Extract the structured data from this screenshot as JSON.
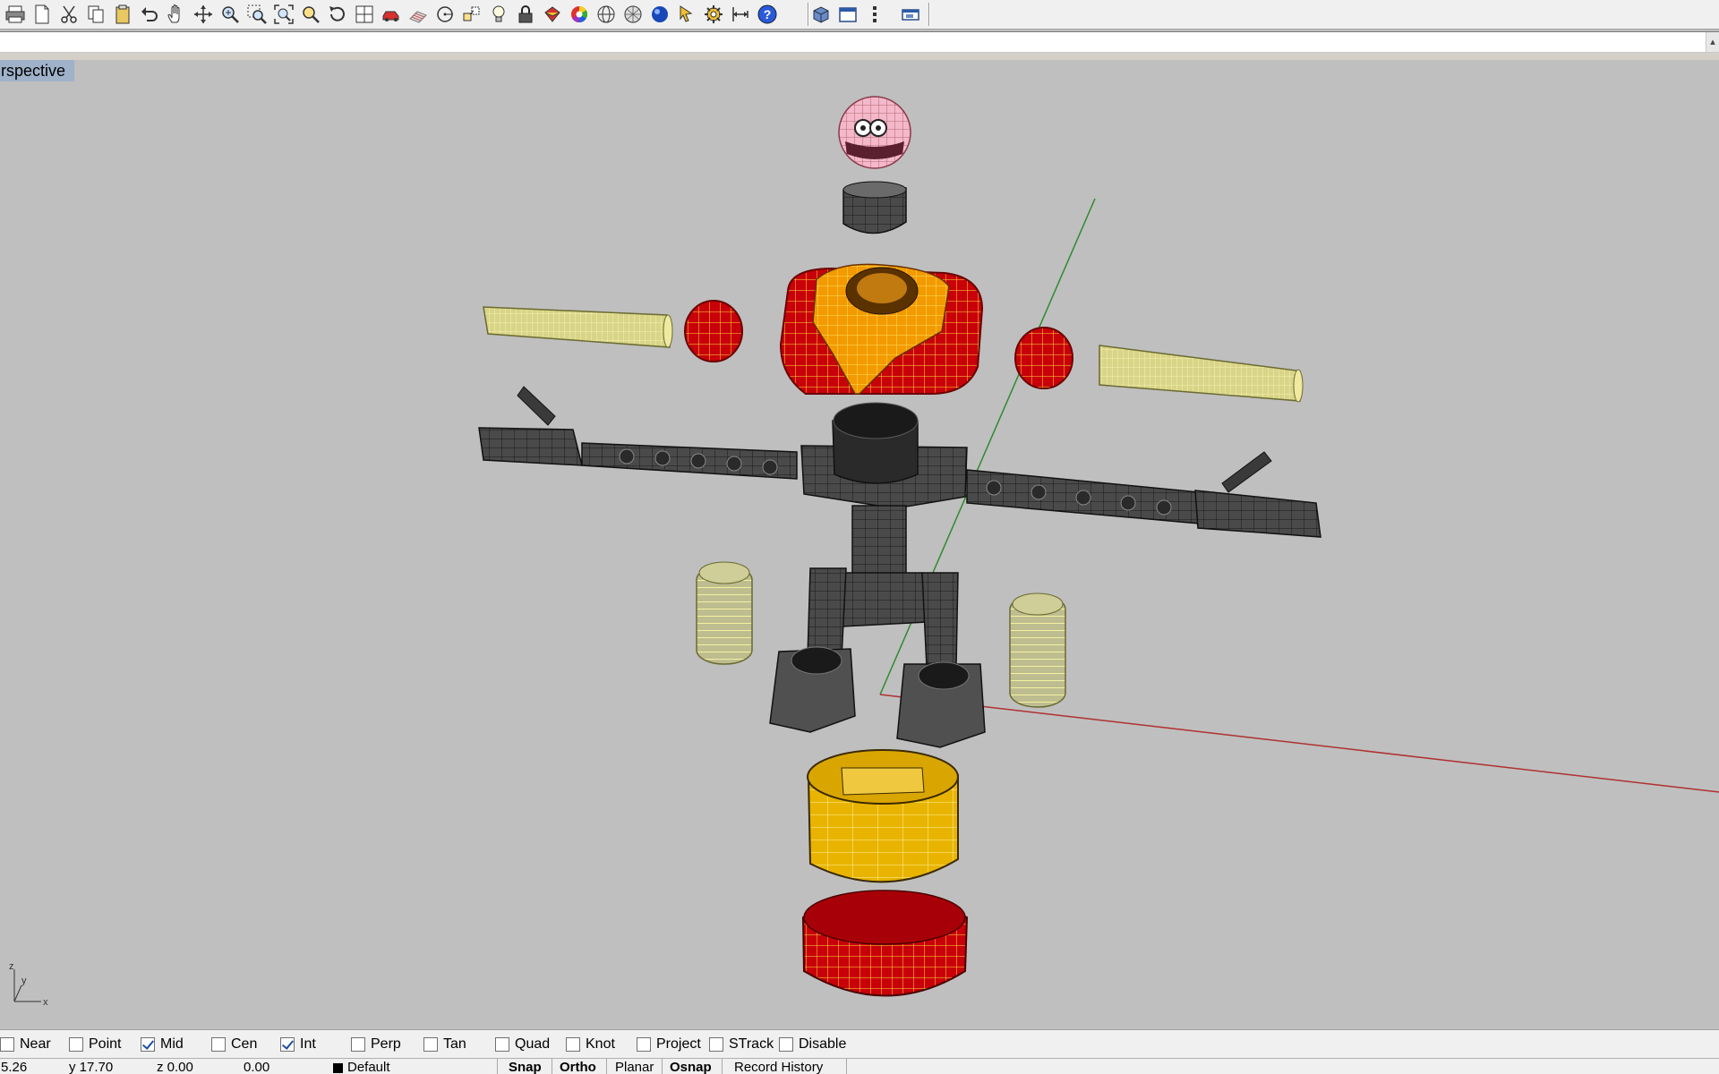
{
  "toolbar": {
    "main_icons": [
      "print-icon",
      "new-document-icon",
      "cut-icon",
      "copy-icon",
      "paste-icon",
      "undo-icon",
      "pan-hand-icon",
      "rotate-view-icon",
      "zoom-dynamic-icon",
      "zoom-window-icon",
      "zoom-extents-icon",
      "zoom-selected-icon",
      "undo-view-icon",
      "viewport-layout-icon",
      "car-icon",
      "grid-icon",
      "circle-select-icon",
      "transform-icon",
      "light-bulb-icon",
      "lock-icon",
      "paint-bucket-icon",
      "color-wheel-icon",
      "sphere-wire-icon",
      "render-mesh-icon",
      "blue-sphere-icon",
      "pointer-icon",
      "gear-settings-icon",
      "dimension-icon",
      "help-icon"
    ],
    "secondary_icons": [
      "cube-view-icon",
      "window-icon",
      "vertical-dots-icon"
    ],
    "end_icon": "maximize-icon"
  },
  "command_line": {
    "value": ""
  },
  "viewport": {
    "title": "rspective",
    "axis_labels": {
      "x": "x",
      "y": "y",
      "z": "z"
    }
  },
  "osnap": [
    {
      "label": "Near",
      "checked": false
    },
    {
      "label": "Point",
      "checked": false
    },
    {
      "label": "Mid",
      "checked": true
    },
    {
      "label": "Cen",
      "checked": false
    },
    {
      "label": "Int",
      "checked": true
    },
    {
      "label": "Perp",
      "checked": false
    },
    {
      "label": "Tan",
      "checked": false
    },
    {
      "label": "Quad",
      "checked": false
    },
    {
      "label": "Knot",
      "checked": false
    },
    {
      "label": "Project",
      "checked": false
    },
    {
      "label": "STrack",
      "checked": false
    },
    {
      "label": "Disable",
      "checked": false
    }
  ],
  "status": {
    "x": "5.26",
    "y": "y 17.70",
    "z": "z 0.00",
    "distance": "0.00",
    "layer": "Default",
    "snap": "Snap",
    "ortho": "Ortho",
    "planar": "Planar",
    "osnap": "Osnap",
    "record_history": "Record History"
  },
  "colors": {
    "viewport_bg": "#bfbfbf",
    "title_tab": "#9fb2c9",
    "x_axis": "#b03030",
    "y_axis": "#2f8a2f",
    "red_part": "#c8000a",
    "orange_part": "#f09a00",
    "yellow_part": "#e8b400",
    "cream_part": "#ece89a",
    "pink_part": "#f2b5c8",
    "dark_part": "#3a3a3a"
  }
}
